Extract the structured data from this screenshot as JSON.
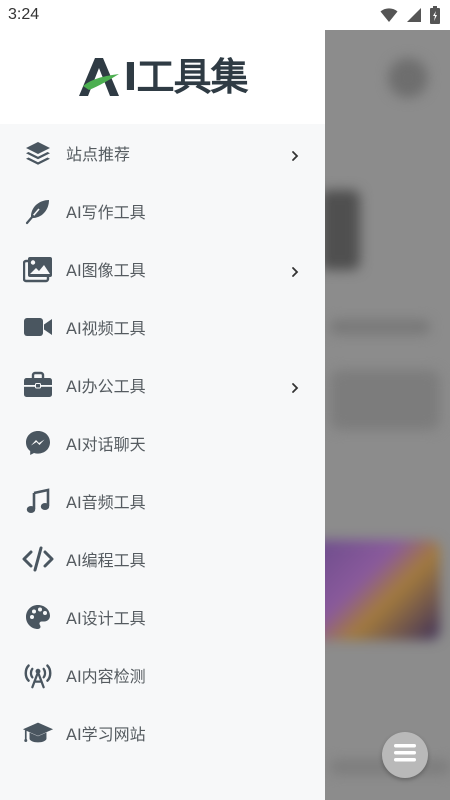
{
  "status_bar": {
    "time": "3:24"
  },
  "drawer": {
    "logo": {
      "letter_a": "A",
      "text": "I工具集"
    },
    "items": [
      {
        "label": "站点推荐",
        "icon": "layers-icon",
        "has_submenu": true
      },
      {
        "label": "AI写作工具",
        "icon": "feather-icon",
        "has_submenu": false
      },
      {
        "label": "AI图像工具",
        "icon": "images-icon",
        "has_submenu": true
      },
      {
        "label": "AI视频工具",
        "icon": "video-camera-icon",
        "has_submenu": false
      },
      {
        "label": "AI办公工具",
        "icon": "briefcase-icon",
        "has_submenu": true
      },
      {
        "label": "AI对话聊天",
        "icon": "messenger-icon",
        "has_submenu": false
      },
      {
        "label": "AI音频工具",
        "icon": "music-note-icon",
        "has_submenu": false
      },
      {
        "label": "AI编程工具",
        "icon": "code-icon",
        "has_submenu": false
      },
      {
        "label": "AI设计工具",
        "icon": "palette-icon",
        "has_submenu": false
      },
      {
        "label": "AI内容检测",
        "icon": "broadcast-icon",
        "has_submenu": false
      },
      {
        "label": "AI学习网站",
        "icon": "graduation-cap-icon",
        "has_submenu": false
      }
    ]
  },
  "colors": {
    "icon": "#4a5660",
    "label": "#555b60",
    "logo_green": "#4caf50",
    "logo_dark": "#2f3b44"
  }
}
